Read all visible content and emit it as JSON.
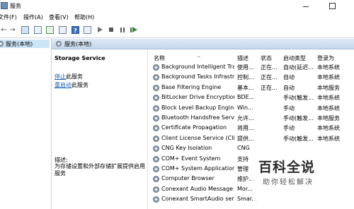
{
  "window": {
    "title": "服务"
  },
  "menu": [
    "文件(F)",
    "操作(A)",
    "查看(V)",
    "帮助(H)"
  ],
  "toolbar": {
    "help_glyph": "?",
    "icons": [
      "back-arrow-icon",
      "forward-arrow-icon",
      "console-tree-icon",
      "properties-icon",
      "refresh-icon",
      "export-list-icon",
      "help-icon",
      "description-pane-icon",
      "start-service-icon",
      "stop-service-icon",
      "pause-service-icon",
      "restart-service-icon"
    ]
  },
  "tree": {
    "root_label": "服务(本地)"
  },
  "content_header": {
    "label": "服务(本地)"
  },
  "description_pane": {
    "service_name": "Storage Service",
    "stop_link": "停止",
    "stop_suffix": "此服务",
    "restart_link": "重启动",
    "restart_suffix": "此服务",
    "desc_label": "描述:",
    "desc_text": "为存储设置和外部存储扩展提供启用服务"
  },
  "list": {
    "columns": {
      "name": "名称",
      "description": "描述",
      "status": "状态",
      "startup_type": "启动类型",
      "logon_as": "登录为"
    },
    "rows": [
      {
        "name": "Background Intelligent Tra...",
        "description": "使用...",
        "status": "正在...",
        "startup_type": "自动(延迟...",
        "logon_as": "本地系统"
      },
      {
        "name": "Background Tasks Infrastru...",
        "description": "控制...",
        "status": "正在...",
        "startup_type": "自动",
        "logon_as": "本地系统"
      },
      {
        "name": "Base Filtering Engine",
        "description": "基本...",
        "status": "正在...",
        "startup_type": "自动",
        "logon_as": "本地服务"
      },
      {
        "name": "BitLocker Drive Encryption ...",
        "description": "BDE...",
        "status": "",
        "startup_type": "手动(触发...",
        "logon_as": "本地系统"
      },
      {
        "name": "Block Level Backup Engine ...",
        "description": "Win...",
        "status": "",
        "startup_type": "手动",
        "logon_as": "本地系统"
      },
      {
        "name": "Bluetooth Handsfree Service",
        "description": "允许...",
        "status": "",
        "startup_type": "手动(触发...",
        "logon_as": "本地服务"
      },
      {
        "name": "Certificate Propagation",
        "description": "将用...",
        "status": "",
        "startup_type": "手动",
        "logon_as": "本地系统"
      },
      {
        "name": "Client License Service (Clip...",
        "description": "提供...",
        "status": "",
        "startup_type": "手动(触发...",
        "logon_as": "本地系统"
      },
      {
        "name": "CNG Key Isolation",
        "description": "CNG",
        "status": "",
        "startup_type": "",
        "logon_as": ""
      },
      {
        "name": "COM+ Event System",
        "description": "支持",
        "status": "",
        "startup_type": "",
        "logon_as": ""
      },
      {
        "name": "COM+ System Application",
        "description": "管理",
        "status": "",
        "startup_type": "",
        "logon_as": ""
      },
      {
        "name": "Computer Browser",
        "description": "维护...",
        "status": "",
        "startup_type": "",
        "logon_as": ""
      },
      {
        "name": "Conexant Audio Message ...",
        "description": "Mor...",
        "status": "",
        "startup_type": "",
        "logon_as": ""
      },
      {
        "name": "Conexant SmartAudio servi...",
        "description": "Smar...",
        "status": "",
        "startup_type": "",
        "logon_as": ""
      }
    ]
  },
  "watermark": {
    "main": "百科全说",
    "sub": "助你轻松解决"
  }
}
